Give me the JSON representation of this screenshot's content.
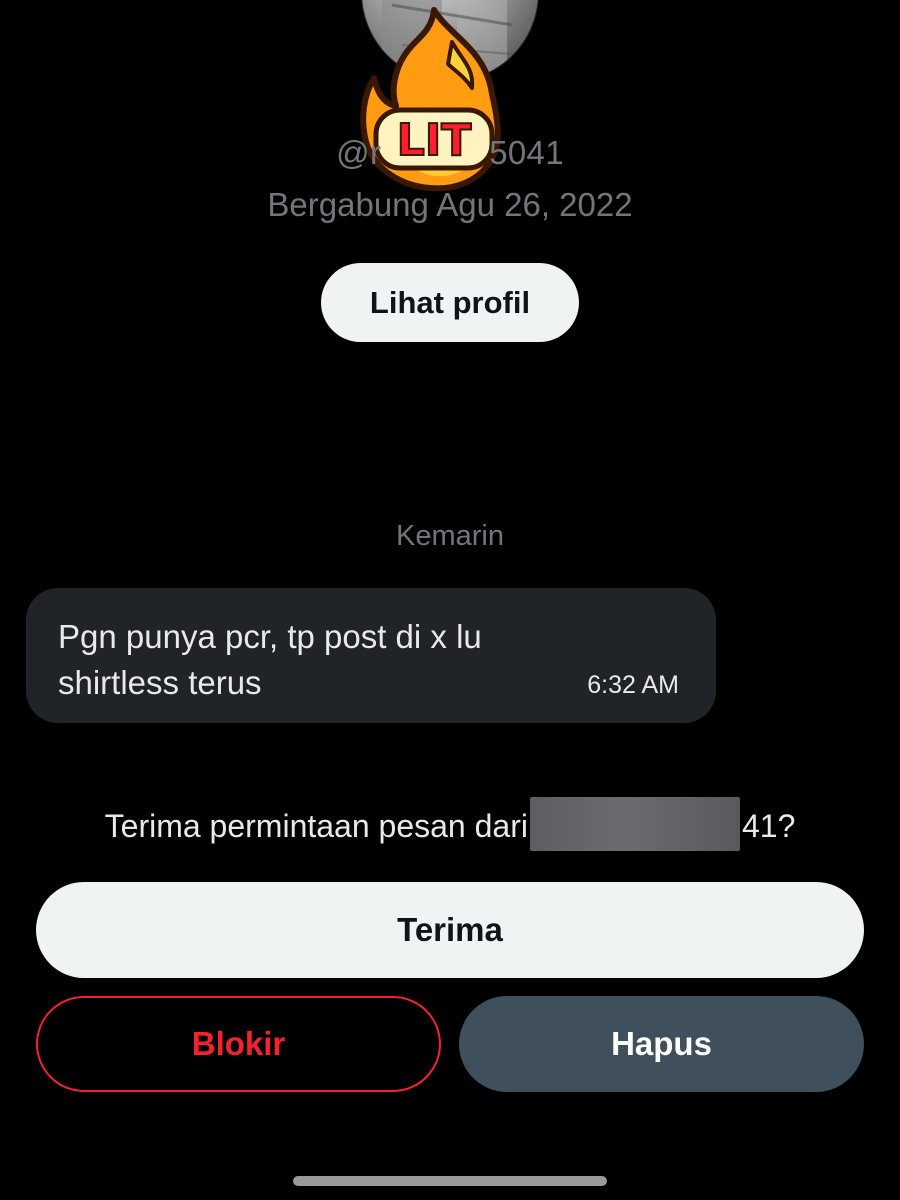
{
  "profile": {
    "username_prefix": "@r",
    "username_suffix": "5041",
    "joined": "Bergabung Agu 26, 2022",
    "view_profile_label": "Lihat profil",
    "sticker_text": "LIT"
  },
  "conversation": {
    "day_separator": "Kemarin",
    "messages": [
      {
        "text": "Pgn punya pcr, tp post di x lu shirtless terus",
        "time": "6:32 AM"
      }
    ]
  },
  "request": {
    "prompt_prefix": "Terima permintaan pesan dari",
    "prompt_suffix": "41?",
    "accept_label": "Terima",
    "block_label": "Blokir",
    "delete_label": "Hapus"
  },
  "colors": {
    "background": "#000000",
    "muted_text": "#71767b",
    "bubble": "#202327",
    "danger": "#f4212e",
    "secondary_button": "#3f4f5c",
    "primary_button": "#eff3f4"
  }
}
